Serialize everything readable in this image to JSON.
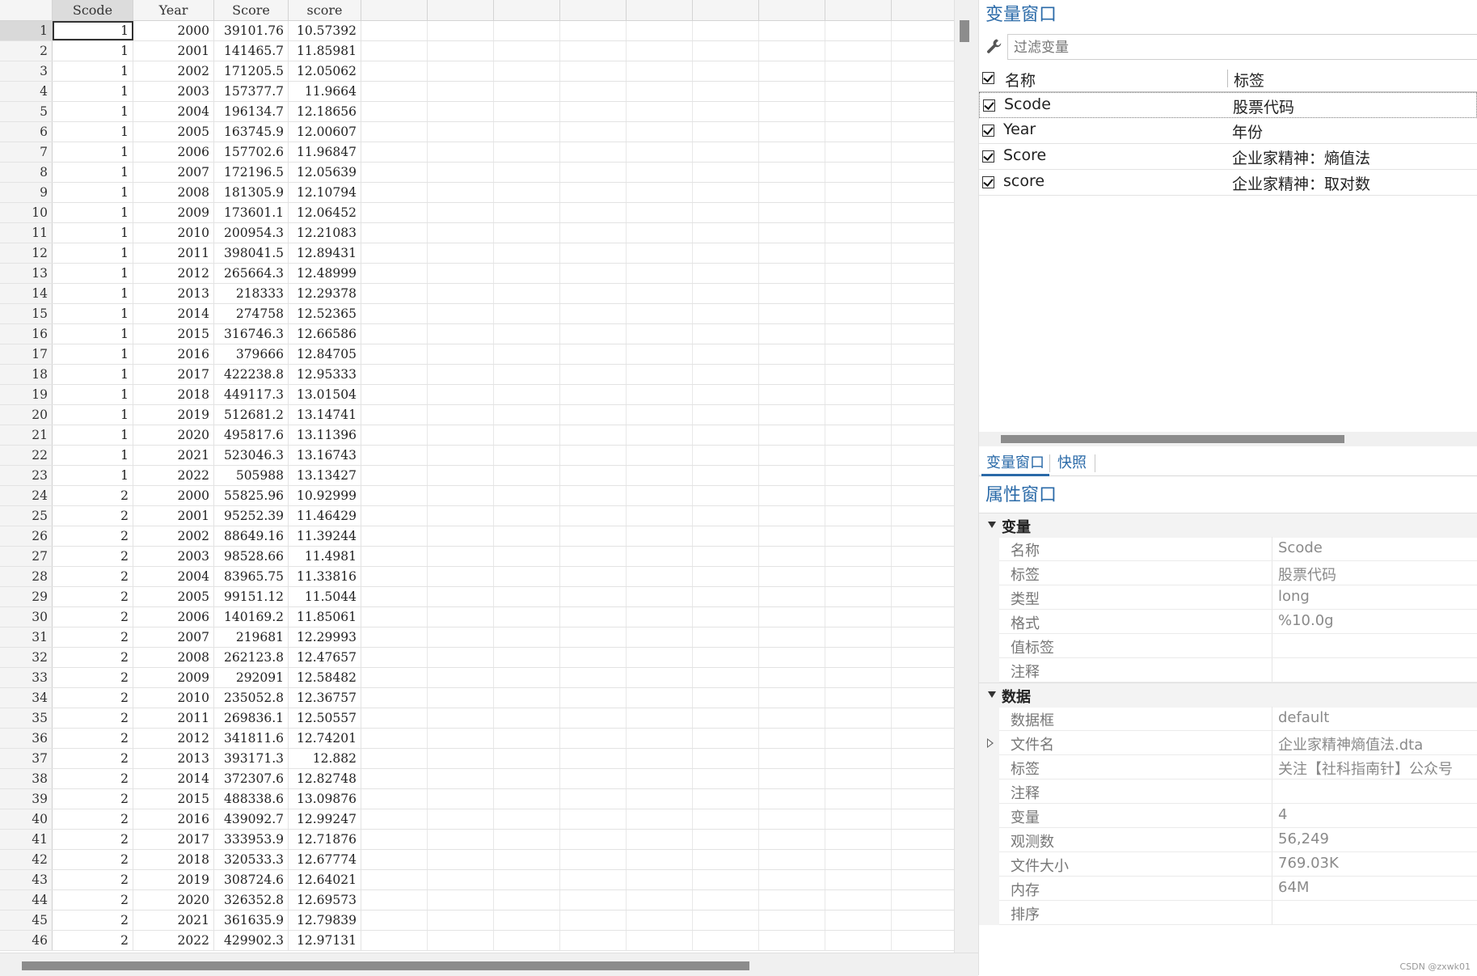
{
  "grid": {
    "columns": [
      "Scode",
      "Year",
      "Score",
      "score"
    ],
    "rows": [
      [
        "1",
        "1",
        "2000",
        "39101.76",
        "10.57392"
      ],
      [
        "2",
        "1",
        "2001",
        "141465.7",
        "11.85981"
      ],
      [
        "3",
        "1",
        "2002",
        "171205.5",
        "12.05062"
      ],
      [
        "4",
        "1",
        "2003",
        "157377.7",
        "11.9664"
      ],
      [
        "5",
        "1",
        "2004",
        "196134.7",
        "12.18656"
      ],
      [
        "6",
        "1",
        "2005",
        "163745.9",
        "12.00607"
      ],
      [
        "7",
        "1",
        "2006",
        "157702.6",
        "11.96847"
      ],
      [
        "8",
        "1",
        "2007",
        "172196.5",
        "12.05639"
      ],
      [
        "9",
        "1",
        "2008",
        "181305.9",
        "12.10794"
      ],
      [
        "10",
        "1",
        "2009",
        "173601.1",
        "12.06452"
      ],
      [
        "11",
        "1",
        "2010",
        "200954.3",
        "12.21083"
      ],
      [
        "12",
        "1",
        "2011",
        "398041.5",
        "12.89431"
      ],
      [
        "13",
        "1",
        "2012",
        "265664.3",
        "12.48999"
      ],
      [
        "14",
        "1",
        "2013",
        "218333",
        "12.29378"
      ],
      [
        "15",
        "1",
        "2014",
        "274758",
        "12.52365"
      ],
      [
        "16",
        "1",
        "2015",
        "316746.3",
        "12.66586"
      ],
      [
        "17",
        "1",
        "2016",
        "379666",
        "12.84705"
      ],
      [
        "18",
        "1",
        "2017",
        "422238.8",
        "12.95333"
      ],
      [
        "19",
        "1",
        "2018",
        "449117.3",
        "13.01504"
      ],
      [
        "20",
        "1",
        "2019",
        "512681.2",
        "13.14741"
      ],
      [
        "21",
        "1",
        "2020",
        "495817.6",
        "13.11396"
      ],
      [
        "22",
        "1",
        "2021",
        "523046.3",
        "13.16743"
      ],
      [
        "23",
        "1",
        "2022",
        "505988",
        "13.13427"
      ],
      [
        "24",
        "2",
        "2000",
        "55825.96",
        "10.92999"
      ],
      [
        "25",
        "2",
        "2001",
        "95252.39",
        "11.46429"
      ],
      [
        "26",
        "2",
        "2002",
        "88649.16",
        "11.39244"
      ],
      [
        "27",
        "2",
        "2003",
        "98528.66",
        "11.4981"
      ],
      [
        "28",
        "2",
        "2004",
        "83965.75",
        "11.33816"
      ],
      [
        "29",
        "2",
        "2005",
        "99151.12",
        "11.5044"
      ],
      [
        "30",
        "2",
        "2006",
        "140169.2",
        "11.85061"
      ],
      [
        "31",
        "2",
        "2007",
        "219681",
        "12.29993"
      ],
      [
        "32",
        "2",
        "2008",
        "262123.8",
        "12.47657"
      ],
      [
        "33",
        "2",
        "2009",
        "292091",
        "12.58482"
      ],
      [
        "34",
        "2",
        "2010",
        "235052.8",
        "12.36757"
      ],
      [
        "35",
        "2",
        "2011",
        "269836.1",
        "12.50557"
      ],
      [
        "36",
        "2",
        "2012",
        "341811.6",
        "12.74201"
      ],
      [
        "37",
        "2",
        "2013",
        "393171.3",
        "12.882"
      ],
      [
        "38",
        "2",
        "2014",
        "372307.6",
        "12.82748"
      ],
      [
        "39",
        "2",
        "2015",
        "488338.6",
        "13.09876"
      ],
      [
        "40",
        "2",
        "2016",
        "439092.7",
        "12.99247"
      ],
      [
        "41",
        "2",
        "2017",
        "333953.9",
        "12.71876"
      ],
      [
        "42",
        "2",
        "2018",
        "320533.3",
        "12.67774"
      ],
      [
        "43",
        "2",
        "2019",
        "308724.6",
        "12.64021"
      ],
      [
        "44",
        "2",
        "2020",
        "326352.8",
        "12.69573"
      ],
      [
        "45",
        "2",
        "2021",
        "361635.9",
        "12.79839"
      ],
      [
        "46",
        "2",
        "2022",
        "429902.3",
        "12.97131"
      ]
    ]
  },
  "variables_window": {
    "title": "变量窗口",
    "filter_placeholder": "过滤变量",
    "header_name": "名称",
    "header_label": "标签",
    "variables": [
      {
        "name": "Scode",
        "label": "股票代码"
      },
      {
        "name": "Year",
        "label": "年份"
      },
      {
        "name": "Score",
        "label": "企业家精神：熵值法"
      },
      {
        "name": "score",
        "label": "企业家精神：取对数"
      }
    ],
    "tabs": [
      "变量窗口",
      "快照"
    ]
  },
  "properties_window": {
    "title": "属性窗口",
    "variable_section": {
      "label": "变量",
      "rows": [
        {
          "name": "名称",
          "value": "Scode"
        },
        {
          "name": "标签",
          "value": "股票代码"
        },
        {
          "name": "类型",
          "value": "long"
        },
        {
          "name": "格式",
          "value": "%10.0g"
        },
        {
          "name": "值标签",
          "value": ""
        },
        {
          "name": "注释",
          "value": ""
        }
      ]
    },
    "data_section": {
      "label": "数据",
      "rows": [
        {
          "name": "数据框",
          "value": "default"
        },
        {
          "name": "文件名",
          "value": "企业家精神熵值法.dta"
        },
        {
          "name": "标签",
          "value": "关注【社科指南针】公众号"
        },
        {
          "name": "注释",
          "value": ""
        },
        {
          "name": "变量",
          "value": "4"
        },
        {
          "name": "观测数",
          "value": "56,249"
        },
        {
          "name": "文件大小",
          "value": "769.03K"
        },
        {
          "name": "内存",
          "value": "64M"
        },
        {
          "name": "排序",
          "value": ""
        }
      ]
    }
  },
  "watermark": "CSDN @zxwk01"
}
